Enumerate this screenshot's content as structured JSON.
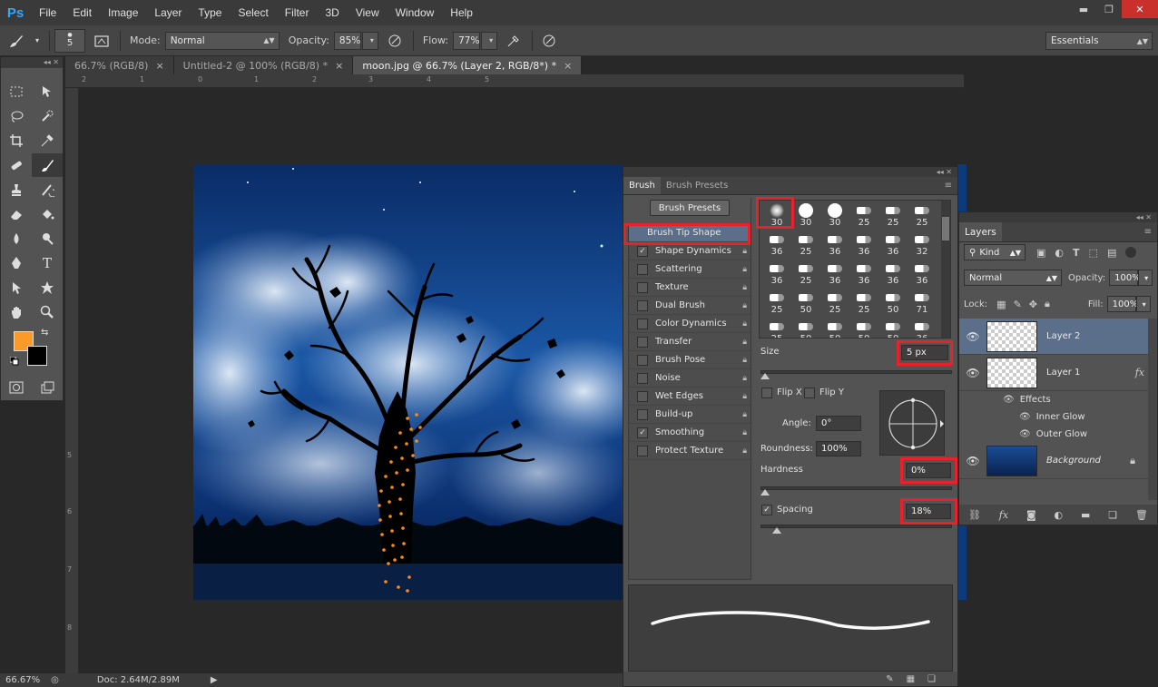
{
  "app": {
    "logo": "Ps"
  },
  "menu": [
    "File",
    "Edit",
    "Image",
    "Layer",
    "Type",
    "Select",
    "Filter",
    "3D",
    "View",
    "Window",
    "Help"
  ],
  "window_controls": {
    "minimize": "▬",
    "restore": "❐",
    "close": "✕"
  },
  "options_bar": {
    "brush_size": "5",
    "mode_label": "Mode:",
    "mode_value": "Normal",
    "opacity_label": "Opacity:",
    "opacity_value": "85%",
    "flow_label": "Flow:",
    "flow_value": "77%",
    "workspace": "Essentials"
  },
  "doc_tabs": [
    {
      "label": "66.7% (RGB/8)",
      "close": "×"
    },
    {
      "label": "Untitled-2 @ 100% (RGB/8) *",
      "close": "×"
    },
    {
      "label": "moon.jpg @ 66.7% (Layer 2, RGB/8*) *",
      "close": "×"
    }
  ],
  "rulers": {
    "top": [
      "2",
      "1",
      "0",
      "1",
      "2",
      "3",
      "4",
      "5"
    ],
    "left": [
      "5",
      "6",
      "7",
      "8"
    ]
  },
  "tools_panel": {
    "header": "◂◂ ✕"
  },
  "brush_panel": {
    "header": "◂◂ ✕",
    "tabs": [
      "Brush",
      "Brush Presets"
    ],
    "menu": "≡",
    "presets_button": "Brush Presets",
    "list": [
      {
        "label": "Brush Tip Shape",
        "checked": false,
        "selected": true
      },
      {
        "label": "Shape Dynamics",
        "checked": true
      },
      {
        "label": "Scattering",
        "checked": false
      },
      {
        "label": "Texture",
        "checked": false
      },
      {
        "label": "Dual Brush",
        "checked": false
      },
      {
        "label": "Color Dynamics",
        "checked": false
      },
      {
        "label": "Transfer",
        "checked": false
      },
      {
        "label": "Brush Pose",
        "checked": false
      },
      {
        "label": "Noise",
        "checked": false
      },
      {
        "label": "Wet Edges",
        "checked": false
      },
      {
        "label": "Build-up",
        "checked": false
      },
      {
        "label": "Smoothing",
        "checked": true
      },
      {
        "label": "Protect Texture",
        "checked": false
      }
    ],
    "tip_sizes": [
      "30",
      "30",
      "30",
      "25",
      "25",
      "25",
      "36",
      "25",
      "36",
      "36",
      "36",
      "32",
      "36",
      "25",
      "36",
      "36",
      "36",
      "36",
      "25",
      "50",
      "25",
      "25",
      "50",
      "71",
      "25",
      "50",
      "50",
      "50",
      "50",
      "36",
      "",
      "",
      "",
      "",
      "",
      ""
    ],
    "size_label": "Size",
    "size_value": "5 px",
    "flip_x": "Flip X",
    "flip_y": "Flip Y",
    "angle_label": "Angle:",
    "angle_value": "0°",
    "roundness_label": "Roundness:",
    "roundness_value": "100%",
    "hardness_label": "Hardness",
    "hardness_value": "0%",
    "hardness_percent": 0,
    "spacing_label": "Spacing",
    "spacing_value": "18%",
    "spacing_checked": true,
    "footer_icons": [
      "eye-brush-icon",
      "grid-icon",
      "new-preset-icon"
    ]
  },
  "layers_panel": {
    "header": "◂◂ ✕",
    "title": "Layers",
    "menu": "≡",
    "filter_label": "Kind",
    "blend_mode": "Normal",
    "opacity_label": "Opacity:",
    "opacity_value": "100%",
    "lock_label": "Lock:",
    "fill_label": "Fill:",
    "fill_value": "100%",
    "layers": [
      {
        "name": "Layer 2",
        "selected": true,
        "fx": ""
      },
      {
        "name": "Layer 1",
        "selected": false,
        "fx": "fx"
      }
    ],
    "effects_label": "Effects",
    "effects": [
      "Inner Glow",
      "Outer Glow"
    ],
    "background_name": "Background",
    "footer_icons": [
      "link-icon",
      "fx",
      "mask-icon",
      "adjustment-icon",
      "folder-icon",
      "new-layer-icon",
      "trash-icon"
    ]
  },
  "status": {
    "zoom": "66.67%",
    "doc": "Doc: 2.64M/2.89M"
  },
  "colors": {
    "foreground": "#fb9a28",
    "background": "#000000",
    "highlight": "#e8212b"
  }
}
